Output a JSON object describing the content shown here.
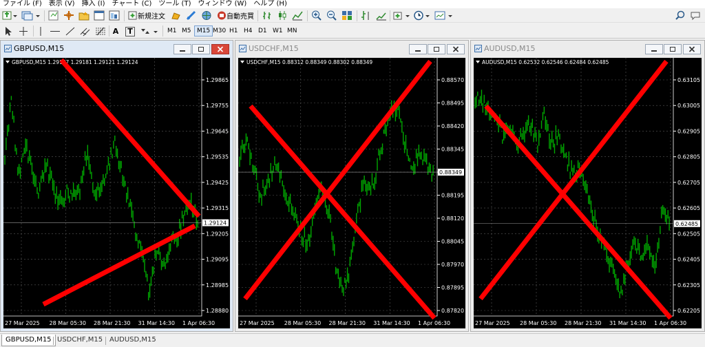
{
  "menu": [
    {
      "name": "menu-file",
      "label": "ファイル (F)"
    },
    {
      "name": "menu-view",
      "label": "表示 (V)"
    },
    {
      "name": "menu-insert",
      "label": "挿入 (I)"
    },
    {
      "name": "menu-chart",
      "label": "チャート (C)"
    },
    {
      "name": "menu-tools",
      "label": "ツール (T)"
    },
    {
      "name": "menu-window",
      "label": "ウィンドウ (W)"
    },
    {
      "name": "menu-help",
      "label": "ヘルプ (H)"
    }
  ],
  "toolbar": {
    "new_order_label": "新規注文",
    "auto_trading_label": "自動売買",
    "timeframes": [
      "M1",
      "M5",
      "M15",
      "M30",
      "H1",
      "H4",
      "D1",
      "W1",
      "MN"
    ],
    "active_timeframe": "M15",
    "text_tool_label": "A",
    "text_label_tool_label": "T"
  },
  "charts": [
    {
      "id": "gbpusd",
      "window_title": "GBPUSD,M15",
      "active": true,
      "info_line": "GBPUSD,M15  1.29177 1.29181 1.29121 1.29124",
      "current_price": "1.29124",
      "price_labels": [
        "1.29865",
        "1.29755",
        "1.29645",
        "1.29535",
        "1.29425",
        "1.29315",
        "1.29205",
        "1.29095",
        "1.28985",
        "1.28880"
      ],
      "time_labels": [
        "27 Mar 2025",
        "28 Mar 05:30",
        "28 Mar 21:30",
        "31 Mar 14:30",
        "1 Apr 06:30"
      ]
    },
    {
      "id": "usdchf",
      "window_title": "USDCHF,M15",
      "active": false,
      "info_line": "USDCHF,M15  0.88312 0.88349 0.88302 0.88349",
      "current_price": "0.88349",
      "price_labels": [
        "0.88570",
        "0.88495",
        "0.88420",
        "0.88345",
        "0.88270",
        "0.88195",
        "0.88120",
        "0.88045",
        "0.87970",
        "0.87895",
        "0.87820"
      ],
      "time_labels": [
        "27 Mar 2025",
        "28 Mar 05:30",
        "28 Mar 21:30",
        "31 Mar 14:30",
        "1 Apr 06:30"
      ]
    },
    {
      "id": "audusd",
      "window_title": "AUDUSD,M15",
      "active": false,
      "info_line": "AUDUSD,M15  0.62532 0.62546 0.62484 0.62485",
      "current_price": "0.62485",
      "price_labels": [
        "0.63105",
        "0.63005",
        "0.62905",
        "0.62805",
        "0.62705",
        "0.62605",
        "0.62505",
        "0.62405",
        "0.62305",
        "0.62205"
      ],
      "time_labels": [
        "27 Mar 2025",
        "28 Mar 05:30",
        "28 Mar 21:30",
        "31 Mar 14:30",
        "1 Apr 06:30"
      ]
    }
  ],
  "tabs": [
    "GBPUSD,M15",
    "USDCHF,M15",
    "AUDUSD,M15"
  ],
  "active_tab": "GBPUSD,M15",
  "colors": {
    "chart_background": "#000000",
    "candle": "#00a800",
    "grid": "#5a5a5a",
    "axis_text": "#ffffff",
    "overlay_cross": "#ff0000"
  }
}
